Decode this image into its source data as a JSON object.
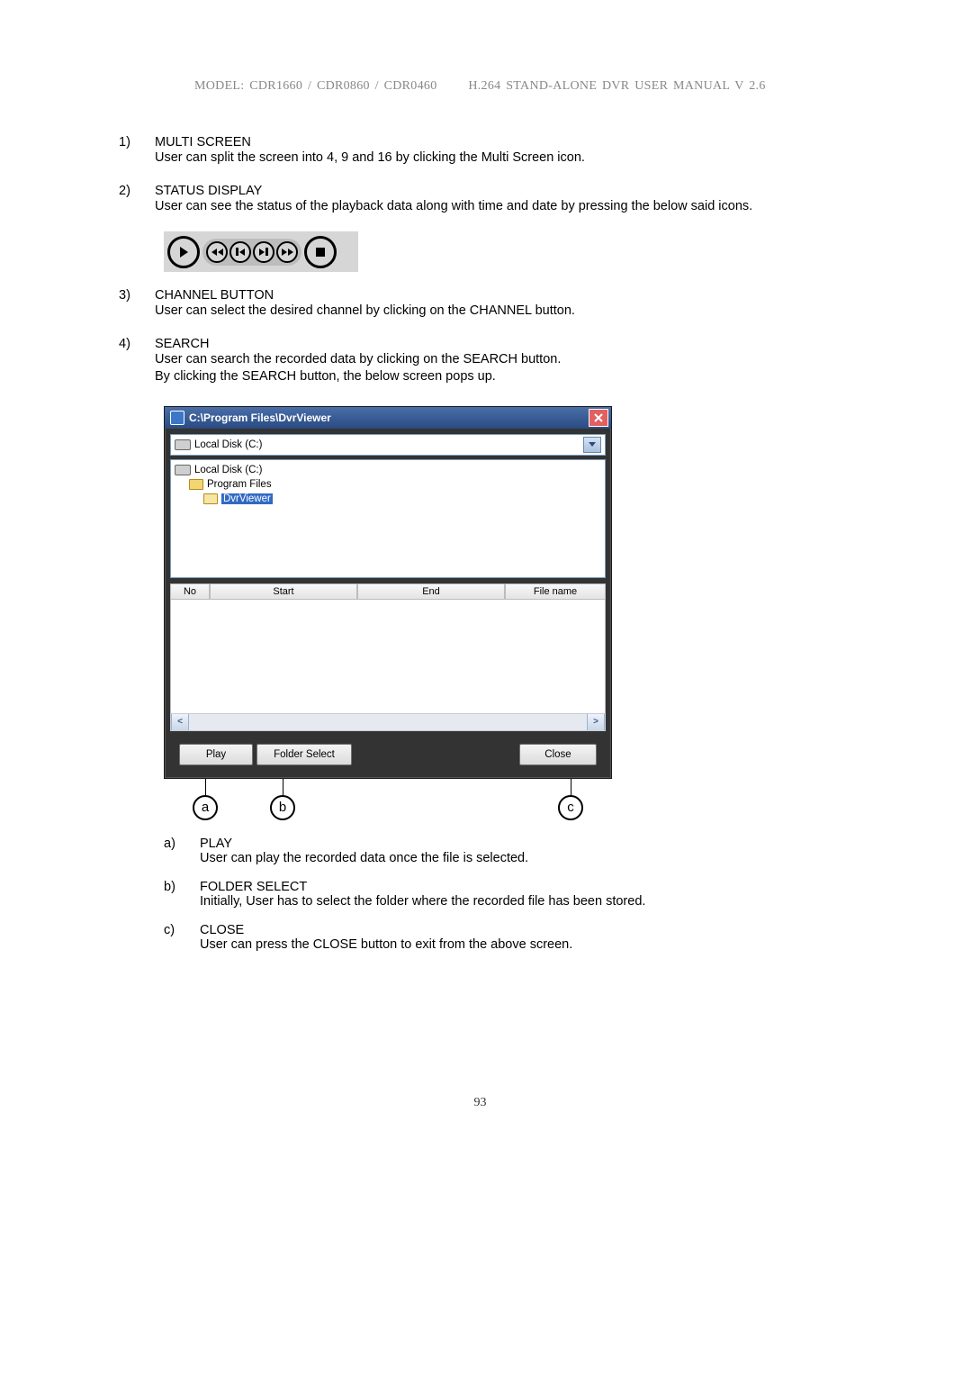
{
  "header": {
    "model": "MODEL: CDR1660 / CDR0860 / CDR0460",
    "manual": "H.264 STAND-ALONE DVR USER MANUAL V 2.6"
  },
  "sections": [
    {
      "num": "1)",
      "title": "MULTI SCREEN",
      "desc": "User can split the screen into 4, 9 and 16 by clicking the Multi Screen icon."
    },
    {
      "num": "2)",
      "title": "STATUS DISPLAY",
      "desc": "User can see the status of the playback data along with time and date by pressing the below said icons."
    },
    {
      "num": "3)",
      "title": "CHANNEL BUTTON",
      "desc": "User can select the desired channel by clicking on the CHANNEL button."
    },
    {
      "num": "4)",
      "title": "SEARCH",
      "desc1": "User can search the recorded data by clicking on the SEARCH button.",
      "desc2": "By clicking the SEARCH button, the below screen pops up."
    }
  ],
  "playback_icons": {
    "names": [
      "play",
      "rewind",
      "prev",
      "next",
      "fast-forward",
      "stop"
    ]
  },
  "dialog": {
    "title": "C:\\Program Files\\DvrViewer",
    "drive_selected": "Local Disk (C:)",
    "tree": {
      "root": "Local Disk (C:)",
      "folder1": "Program Files",
      "folder2": "DvrViewer"
    },
    "columns": {
      "no": "No",
      "start": "Start",
      "end": "End",
      "filename": "File name"
    },
    "buttons": {
      "play": "Play",
      "folder_select": "Folder Select",
      "close": "Close"
    }
  },
  "annotations": {
    "a": "a",
    "b": "b",
    "c": "c"
  },
  "subsections": [
    {
      "num": "a)",
      "title": "PLAY",
      "desc": "User can play the recorded data once the file is selected."
    },
    {
      "num": "b)",
      "title": "FOLDER SELECT",
      "desc": "Initially, User has to select the folder where the recorded file has been stored."
    },
    {
      "num": "c)",
      "title": "CLOSE",
      "desc": "User can press the CLOSE button to exit from the above screen."
    }
  ],
  "page_number": "93"
}
